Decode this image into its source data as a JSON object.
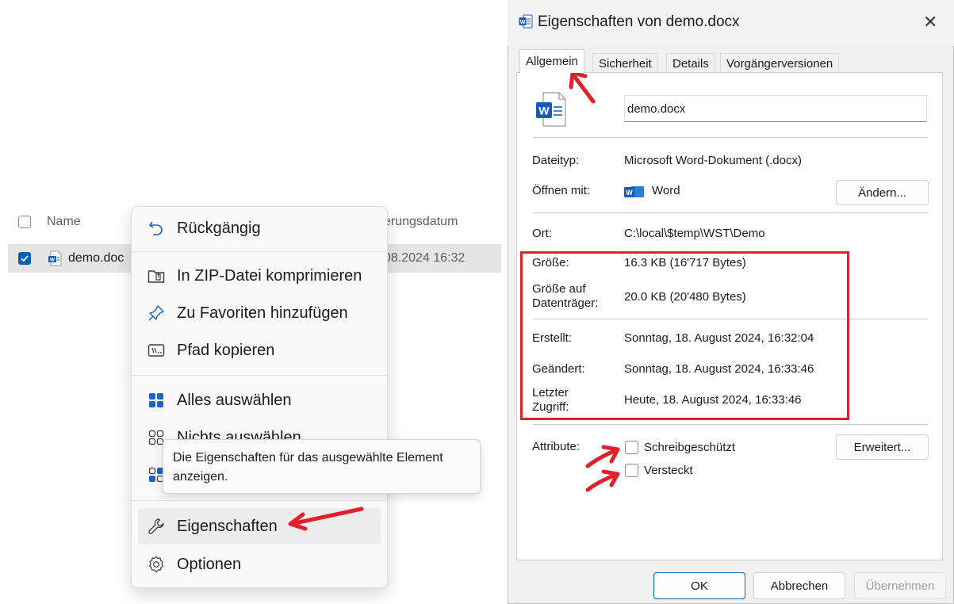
{
  "explorer": {
    "col_name": "Name",
    "col_date": "erungsdatum",
    "file_name": "demo.doc",
    "file_date": "08.2024 16:32"
  },
  "menu": {
    "items": [
      {
        "label": "Rückgängig",
        "icon": "undo-icon"
      },
      {
        "label": "In ZIP-Datei komprimieren",
        "icon": "zip-folder-icon"
      },
      {
        "label": "Zu Favoriten hinzufügen",
        "icon": "pin-icon"
      },
      {
        "label": "Pfad kopieren",
        "icon": "path-icon"
      },
      {
        "label": "Alles auswählen",
        "icon": "select-all-icon"
      },
      {
        "label": "Nichts auswählen",
        "icon": "select-none-icon"
      },
      {
        "label": "Eigenschaften",
        "icon": "wrench-icon"
      },
      {
        "label": "Optionen",
        "icon": "gear-icon"
      }
    ],
    "tooltip": "Die Eigenschaften für das ausgewählte Element anzeigen."
  },
  "dialog": {
    "title": "Eigenschaften von demo.docx",
    "tabs": [
      "Allgemein",
      "Sicherheit",
      "Details",
      "Vorgängerversionen"
    ],
    "file_name": "demo.docx",
    "rows": {
      "type_label": "Dateityp:",
      "type_value": "Microsoft Word-Dokument (.docx)",
      "open_label": "Öffnen mit:",
      "open_value": "Word",
      "change_button": "Ändern...",
      "location_label": "Ort:",
      "location_value": "C:\\local\\$temp\\WST\\Demo",
      "size_label": "Größe:",
      "size_value": "16.3 KB (16'717 Bytes)",
      "disk_size_label_1": "Größe auf",
      "disk_size_label_2": "Datenträger:",
      "disk_size_value": "20.0 KB (20'480 Bytes)",
      "created_label": "Erstellt:",
      "created_value": "Sonntag, 18. August 2024, 16:32:04",
      "modified_label": "Geändert:",
      "modified_value": "Sonntag, 18. August 2024, 16:33:46",
      "accessed_label_1": "Letzter",
      "accessed_label_2": "Zugriff:",
      "accessed_value": "Heute, 18. August 2024, 16:33:46",
      "attributes_label": "Attribute:",
      "readonly_label": "Schreibgeschützt",
      "hidden_label": "Versteckt",
      "advanced_button": "Erweitert..."
    },
    "buttons": {
      "ok": "OK",
      "cancel": "Abbrechen",
      "apply": "Übernehmen"
    }
  },
  "colors": {
    "accent": "#005fb8",
    "word_blue": "#185abd",
    "annotation_red": "#e0202b"
  }
}
